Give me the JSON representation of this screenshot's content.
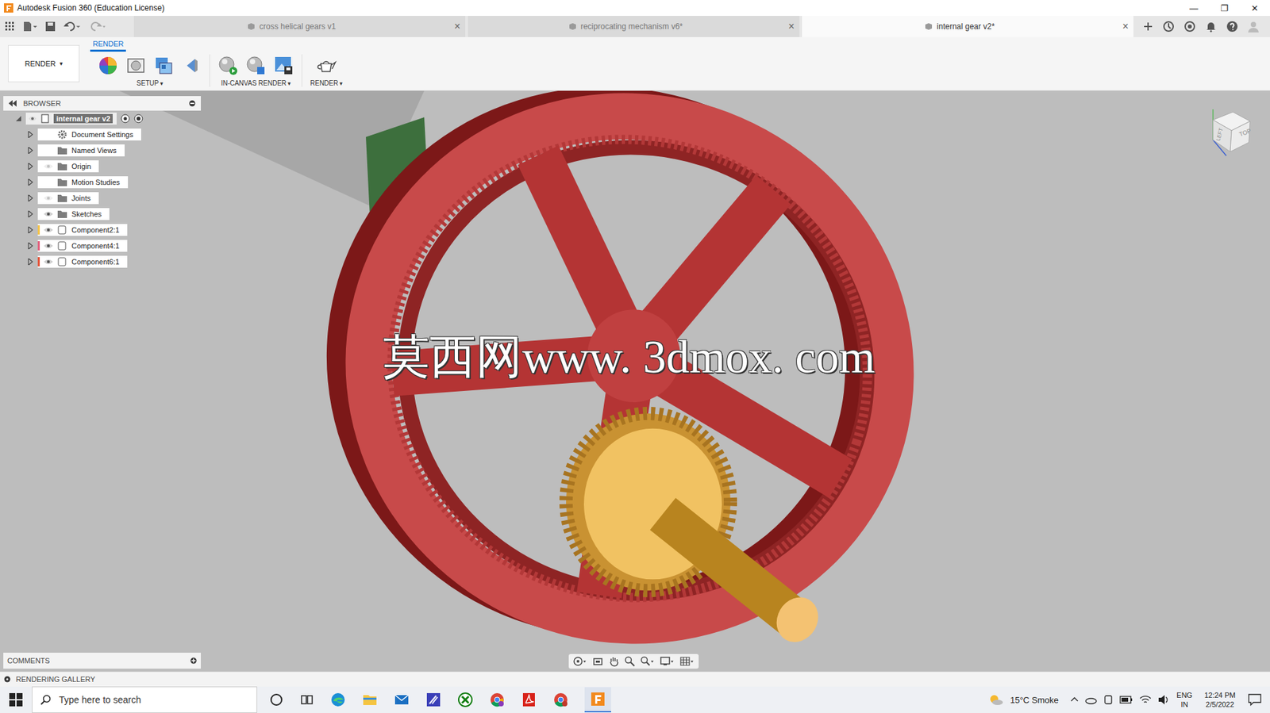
{
  "window": {
    "title": "Autodesk Fusion 360 (Education License)",
    "controls": [
      "—",
      "❐",
      "✕"
    ]
  },
  "tabs": [
    {
      "label": "cross helical gears v1",
      "selected": false
    },
    {
      "label": "reciprocating mechanism v6*",
      "selected": false
    },
    {
      "label": "internal gear v2*",
      "selected": true
    }
  ],
  "tab_close": "×",
  "toolbar": {
    "workspace": {
      "label": "RENDER",
      "caret": "▾"
    },
    "active_tab": "RENDER",
    "groups": [
      {
        "label": "SETUP",
        "caret": "▾"
      },
      {
        "label": "IN-CANVAS RENDER",
        "caret": "▾"
      },
      {
        "label": "RENDER",
        "caret": "▾"
      }
    ]
  },
  "browser": {
    "title": "BROWSER",
    "root": {
      "label": "internal gear v2",
      "selected": true
    },
    "items": [
      {
        "label": "Document Settings",
        "kind": "settings",
        "has_eye": false,
        "visible": false
      },
      {
        "label": "Named Views",
        "kind": "folder",
        "has_eye": false,
        "visible": false
      },
      {
        "label": "Origin",
        "kind": "folder",
        "has_eye": true,
        "visible": false
      },
      {
        "label": "Motion Studies",
        "kind": "folder",
        "has_eye": false,
        "visible": false
      },
      {
        "label": "Joints",
        "kind": "folder",
        "has_eye": true,
        "visible": false
      },
      {
        "label": "Sketches",
        "kind": "folder",
        "has_eye": true,
        "visible": true
      },
      {
        "label": "Component2:1",
        "kind": "component",
        "has_eye": true,
        "visible": true,
        "color": "#f2c24a"
      },
      {
        "label": "Component4:1",
        "kind": "component",
        "has_eye": true,
        "visible": true,
        "color": "#e0607e"
      },
      {
        "label": "Component6:1",
        "kind": "component",
        "has_eye": true,
        "visible": true,
        "color": "#e2553a"
      }
    ]
  },
  "comments": {
    "title": "COMMENTS"
  },
  "gallery": {
    "title": "RENDERING GALLERY"
  },
  "viewcube": {
    "faces": [
      "TOP",
      "LEFT"
    ]
  },
  "watermark": "莫西网www. 3dmox. com",
  "taskbar": {
    "search_placeholder": "Type here to search",
    "weather": "15°C Smoke",
    "language": [
      "ENG",
      "IN"
    ],
    "time": "12:24 PM",
    "date": "2/5/2022"
  }
}
